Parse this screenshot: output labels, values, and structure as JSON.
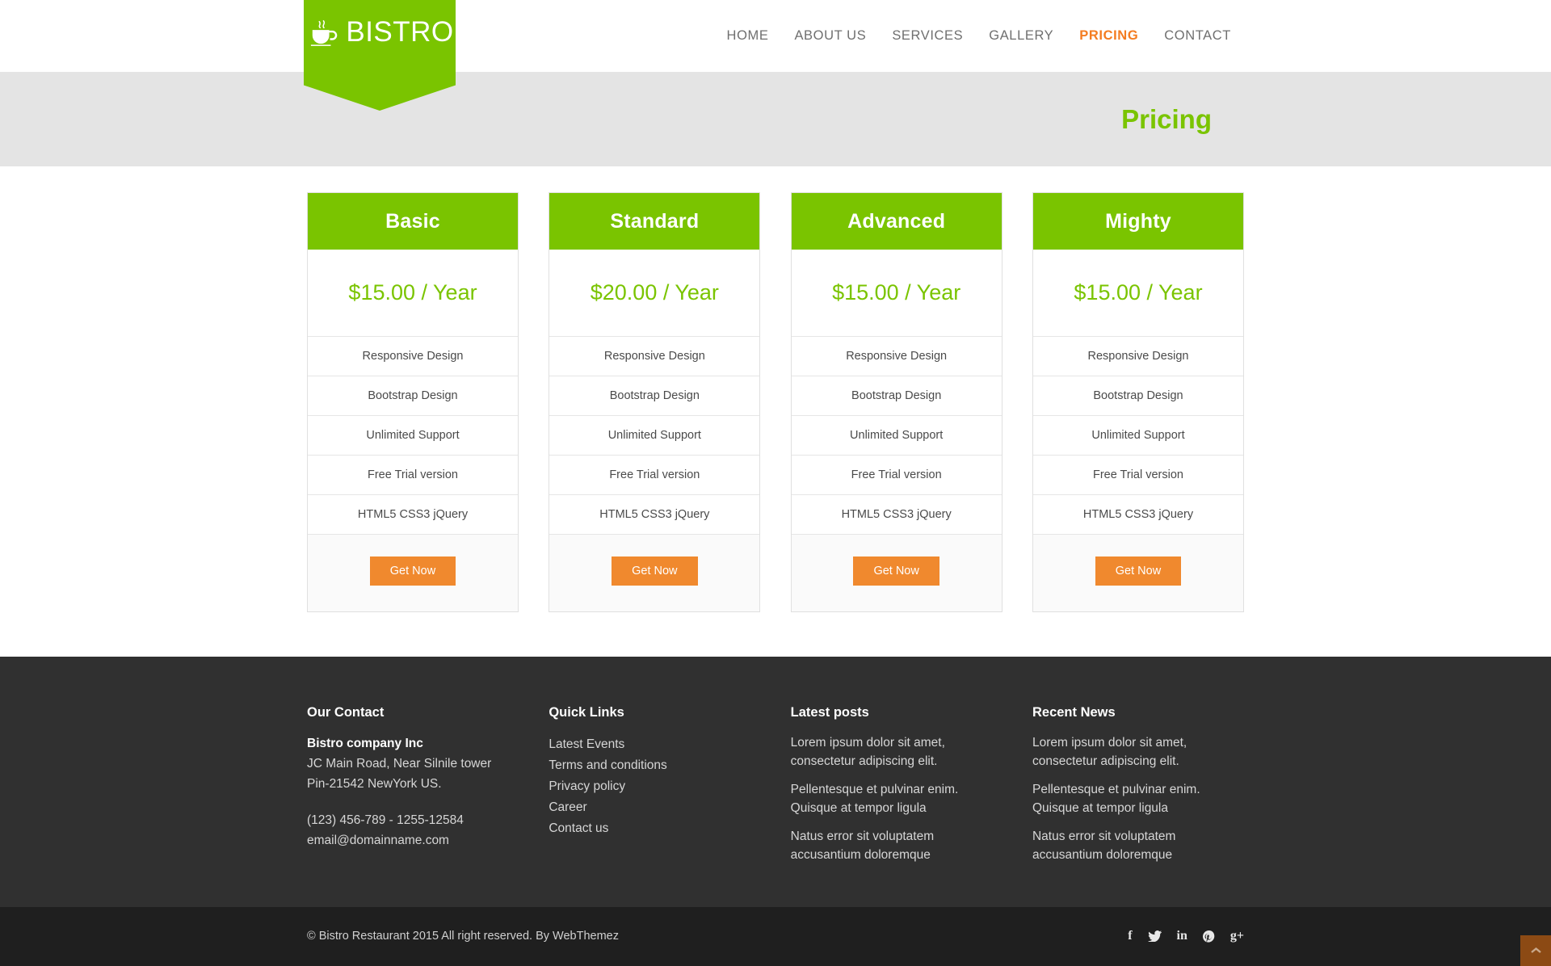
{
  "site": {
    "logo_text": "BISTRO",
    "logo_icon": "coffee-cup-icon",
    "brand_green": "#7ac400",
    "accent_orange": "#f47c20",
    "button_orange": "#f0892e"
  },
  "nav": {
    "items": [
      {
        "label": "HOME",
        "active": false
      },
      {
        "label": "ABOUT US",
        "active": false
      },
      {
        "label": "SERVICES",
        "active": false
      },
      {
        "label": "GALLERY",
        "active": false
      },
      {
        "label": "PRICING",
        "active": true
      },
      {
        "label": "CONTACT",
        "active": false
      }
    ]
  },
  "banner": {
    "title": "Pricing"
  },
  "pricing": {
    "plans": [
      {
        "name": "Basic",
        "price": "$15.00 / Year",
        "features": [
          "Responsive Design",
          "Bootstrap Design",
          "Unlimited Support",
          "Free Trial version",
          "HTML5 CSS3 jQuery"
        ],
        "cta": "Get Now"
      },
      {
        "name": "Standard",
        "price": "$20.00 / Year",
        "features": [
          "Responsive Design",
          "Bootstrap Design",
          "Unlimited Support",
          "Free Trial version",
          "HTML5 CSS3 jQuery"
        ],
        "cta": "Get Now"
      },
      {
        "name": "Advanced",
        "price": "$15.00 / Year",
        "features": [
          "Responsive Design",
          "Bootstrap Design",
          "Unlimited Support",
          "Free Trial version",
          "HTML5 CSS3 jQuery"
        ],
        "cta": "Get Now"
      },
      {
        "name": "Mighty",
        "price": "$15.00 / Year",
        "features": [
          "Responsive Design",
          "Bootstrap Design",
          "Unlimited Support",
          "Free Trial version",
          "HTML5 CSS3 jQuery"
        ],
        "cta": "Get Now"
      }
    ]
  },
  "footer": {
    "contact": {
      "title": "Our Contact",
      "company": "Bistro company Inc",
      "address_line1": "JC Main Road, Near Silnile tower",
      "address_line2": "Pin-21542 NewYork US.",
      "phone": "(123) 456-789 - 1255-12584",
      "email": "email@domainname.com"
    },
    "quick_links": {
      "title": "Quick Links",
      "items": [
        "Latest Events",
        "Terms and conditions",
        "Privacy policy",
        "Career",
        "Contact us"
      ]
    },
    "latest_posts": {
      "title": "Latest posts",
      "items": [
        "Lorem ipsum dolor sit amet, consectetur adipiscing elit.",
        "Pellentesque et pulvinar enim. Quisque at tempor ligula",
        "Natus error sit voluptatem accusantium doloremque"
      ]
    },
    "recent_news": {
      "title": "Recent News",
      "items": [
        "Lorem ipsum dolor sit amet, consectetur adipiscing elit.",
        "Pellentesque et pulvinar enim. Quisque at tempor ligula",
        "Natus error sit voluptatem accusantium doloremque"
      ]
    }
  },
  "bottom": {
    "copyright": "© Bistro Restaurant 2015 All right reserved. By WebThemez",
    "socials": [
      {
        "name": "facebook-icon",
        "glyph": "f"
      },
      {
        "name": "twitter-icon",
        "glyph": ""
      },
      {
        "name": "linkedin-icon",
        "glyph": "in"
      },
      {
        "name": "pinterest-icon",
        "glyph": ""
      },
      {
        "name": "googleplus-icon",
        "glyph": "g+"
      }
    ],
    "scroll_top_icon": "chevron-up-icon"
  }
}
